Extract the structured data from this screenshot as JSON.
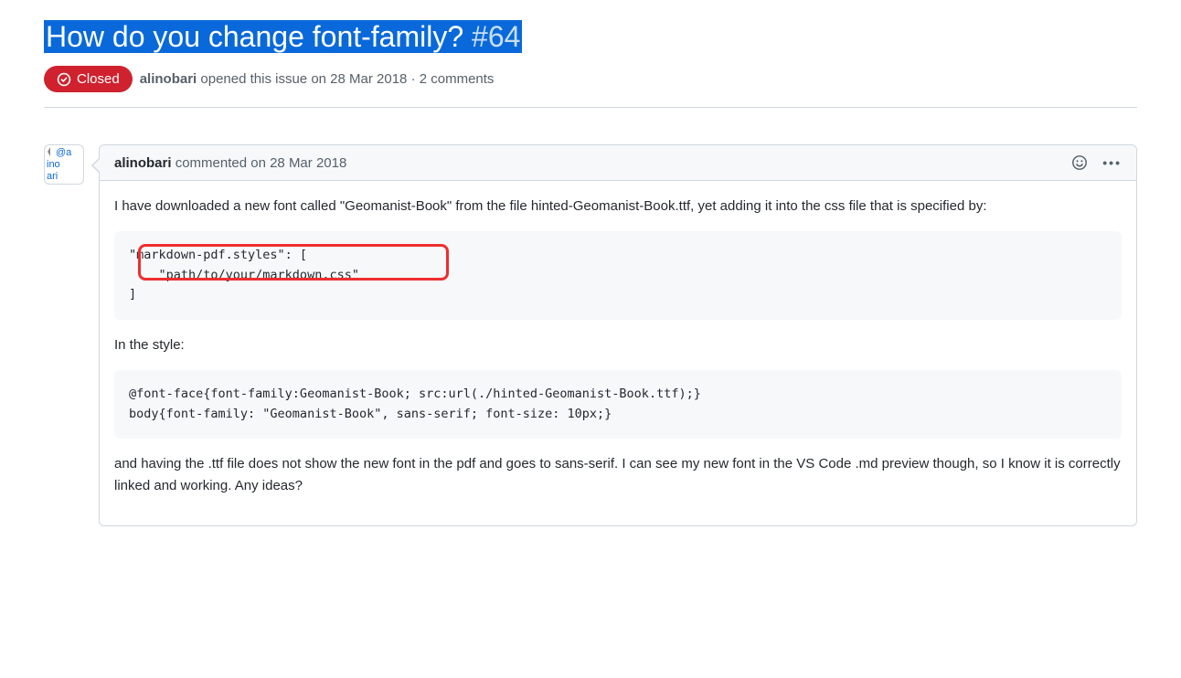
{
  "issue": {
    "title": "How do you change font-family?",
    "number": "#64",
    "state": "Closed",
    "author": "alinobari",
    "opened_verb": "opened this issue",
    "opened_on": "on 28 Mar 2018",
    "separator": "·",
    "comment_count": "2 comments"
  },
  "avatar": {
    "alt_prefix": "@a",
    "alt_line2": "ino",
    "alt_line3": "ari"
  },
  "comment": {
    "author": "alinobari",
    "verb": "commented",
    "on": "on 28 Mar 2018",
    "paragraph_before_code1": "I have downloaded a new font called \"Geomanist-Book\" from the file hinted-Geomanist-Book.ttf, yet adding it into the css file that is specified by:",
    "code1": {
      "line1": "\"markdown-pdf.styles\": [",
      "line2": "    \"path/to/your/markdown.css\"",
      "line3": "]"
    },
    "paragraph_between": "In the style:",
    "code2": {
      "line1": "@font-face{font-family:Geomanist-Book; src:url(./hinted-Geomanist-Book.ttf);}",
      "line2": "body{font-family: \"Geomanist-Book\", sans-serif; font-size: 10px;}"
    },
    "paragraph_after": "and having the .ttf file does not show the new font in the pdf and goes to sans-serif. I can see my new font in the VS Code .md preview though, so I know it is correctly linked and working. Any ideas?"
  },
  "annotations": {
    "highlight_box_label": "highlighted region around stylesheet path"
  }
}
